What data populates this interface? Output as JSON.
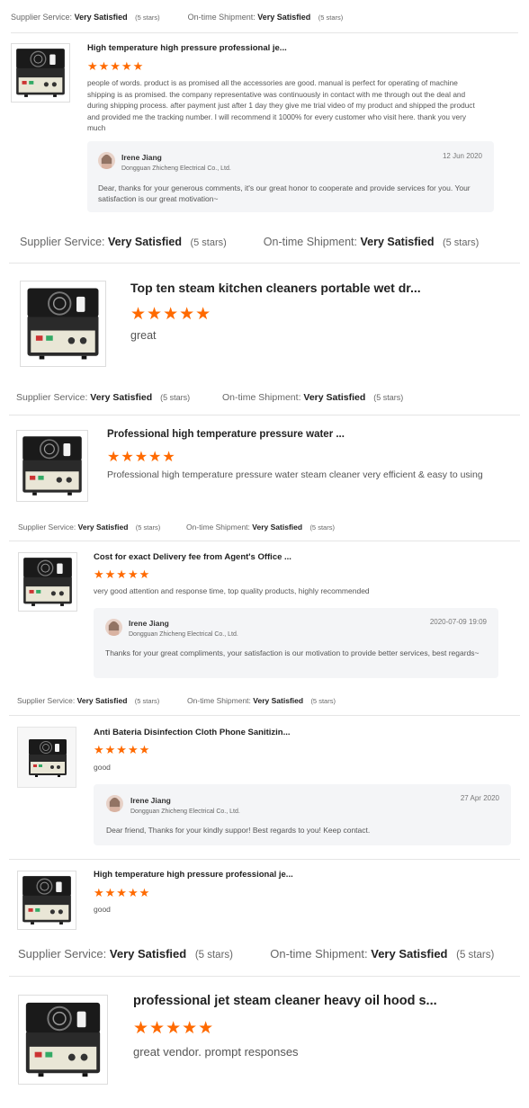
{
  "meta_labels": {
    "supplier": "Supplier Service:",
    "shipment": "On-time Shipment:",
    "rating": "Very Satisfied",
    "count": "(5 stars)"
  },
  "stars": "★★★★★",
  "colors": {
    "star": "#ff6a00",
    "reply_bg": "#f4f5f7",
    "divider": "#e5e5e5"
  },
  "reviews": [
    {
      "title": "High temperature high pressure professional je...",
      "body": "people of words. product is as promised all the accessories are good. manual is perfect for operating of machine shipping is as promised. the company representative was continuously in contact with me through out the deal and during shipping process. after payment just after 1 day they give me trial video of my product and shipped the product and provided me the tracking number. I will recommend it 1000% for every customer who visit here. thank you very much",
      "reply": {
        "name": "Irene Jiang",
        "company": "Dongguan Zhicheng Electrical Co., Ltd.",
        "date": "12 Jun 2020",
        "text": "Dear, thanks for your generous comments, it's our great honor to cooperate and provide services for you. Your satisfaction is our great motivation~"
      }
    },
    {
      "title": "Top ten steam kitchen cleaners portable wet dr...",
      "body": "great"
    },
    {
      "title": "Professional high temperature pressure water ...",
      "body": "Professional high temperature pressure water steam cleaner very efficient & easy to using"
    },
    {
      "title": "Cost for exact Delivery fee from Agent's Office ...",
      "body": "very good attention and response time, top quality products, highly recommended",
      "reply": {
        "name": "Irene Jiang",
        "company": "Dongguan Zhicheng Electrical Co., Ltd.",
        "date": "2020-07-09 19:09",
        "text": "Thanks for  your great compliments,  your satisfaction is our motivation to provide better services, best regards~"
      }
    },
    {
      "title": "Anti Bateria Disinfection Cloth Phone Sanitizin...",
      "body": "good",
      "reply": {
        "name": "Irene Jiang",
        "company": "Dongguan Zhicheng Electrical Co., Ltd.",
        "date": "27 Apr 2020",
        "text": "Dear friend, Thanks for your kindly suppor!  Best regards to you! Keep contact."
      }
    },
    {
      "title": "High temperature high pressure professional je...",
      "body": "good"
    },
    {
      "title": "professional jet steam cleaner heavy oil hood s...",
      "body": "great vendor. prompt responses"
    }
  ]
}
